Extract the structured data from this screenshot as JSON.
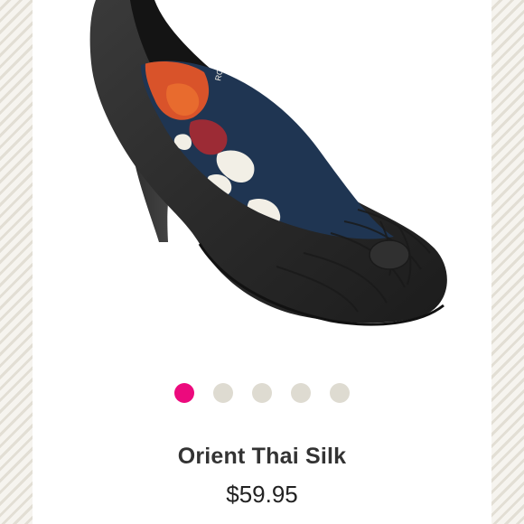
{
  "product": {
    "name": "Orient Thai Silk",
    "price": "$59.95",
    "insole_brand_text": "ROCKET DOG"
  },
  "carousel": {
    "total": 5,
    "active_index": 0,
    "dots": [
      {
        "label": "1",
        "active": true
      },
      {
        "label": "2",
        "active": false
      },
      {
        "label": "3",
        "active": false
      },
      {
        "label": "4",
        "active": false
      },
      {
        "label": "5",
        "active": false
      }
    ]
  },
  "colors": {
    "active_dot": "#ec0a7d",
    "inactive_dot": "#dedbd1",
    "shoe": "#2c2c2c",
    "insole": "#1f3552"
  }
}
